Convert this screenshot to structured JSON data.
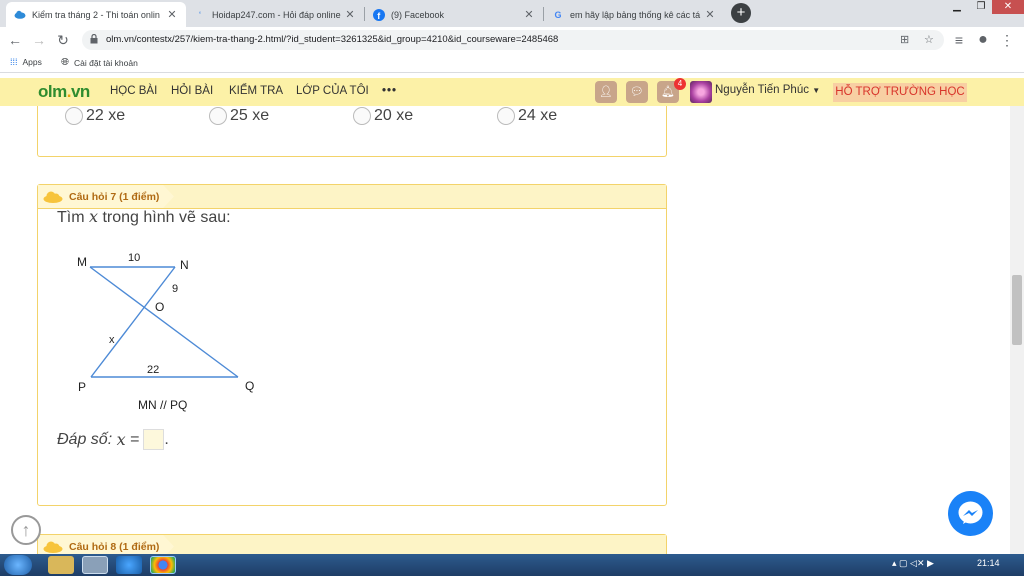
{
  "browser": {
    "tabs": [
      {
        "title": "Kiểm tra tháng 2 - Thi toán onlin",
        "icon": "cloud-icon"
      },
      {
        "title": "Hoidap247.com - Hỏi đáp online",
        "icon": "loading-icon"
      },
      {
        "title": "(9) Facebook",
        "icon": "facebook-icon"
      },
      {
        "title": "em hãy lập bảng thống kê các tá",
        "icon": "google-icon"
      }
    ],
    "url": "olm.vn/contestx/257/kiem-tra-thang-2.html/?id_student=3261325&id_group=4210&id_courseware=2485468",
    "bookmarks": {
      "apps": "Apps",
      "item1": "Cài đặt tài khoản"
    }
  },
  "site_nav": {
    "logo_main": "olm",
    "logo_dot": ".",
    "logo_tld": "vn",
    "items": [
      "HỌC BÀI",
      "HỎI BÀI",
      "KIỂM TRA",
      "LỚP CỦA TÔI"
    ],
    "more": "•••",
    "notification_count": "4",
    "user_name": "Nguyễn Tiến Phúc",
    "support": "HỖ TRỢ TRƯỜNG HỌC"
  },
  "prev_question": {
    "options": [
      "22 xe",
      "25 xe",
      "20 xe",
      "24 xe"
    ]
  },
  "question7": {
    "title": "Câu hỏi 7 (1 điểm)",
    "text_before": "Tìm",
    "variable": "x",
    "text_after": "trong hình vẽ sau:",
    "figure": {
      "labels": {
        "M": "M",
        "N": "N",
        "O": "O",
        "P": "P",
        "Q": "Q"
      },
      "lengths": {
        "MN": "10",
        "NO": "9",
        "OP": "x",
        "PQ": "22"
      },
      "caption": "MN // PQ"
    },
    "answer_label": "Đáp số:",
    "answer_var": "x",
    "answer_eq": "=",
    "answer_end": "."
  },
  "question8": {
    "title": "Câu hỏi 8 (1 điểm)"
  },
  "taskbar": {
    "time": "21:14"
  }
}
